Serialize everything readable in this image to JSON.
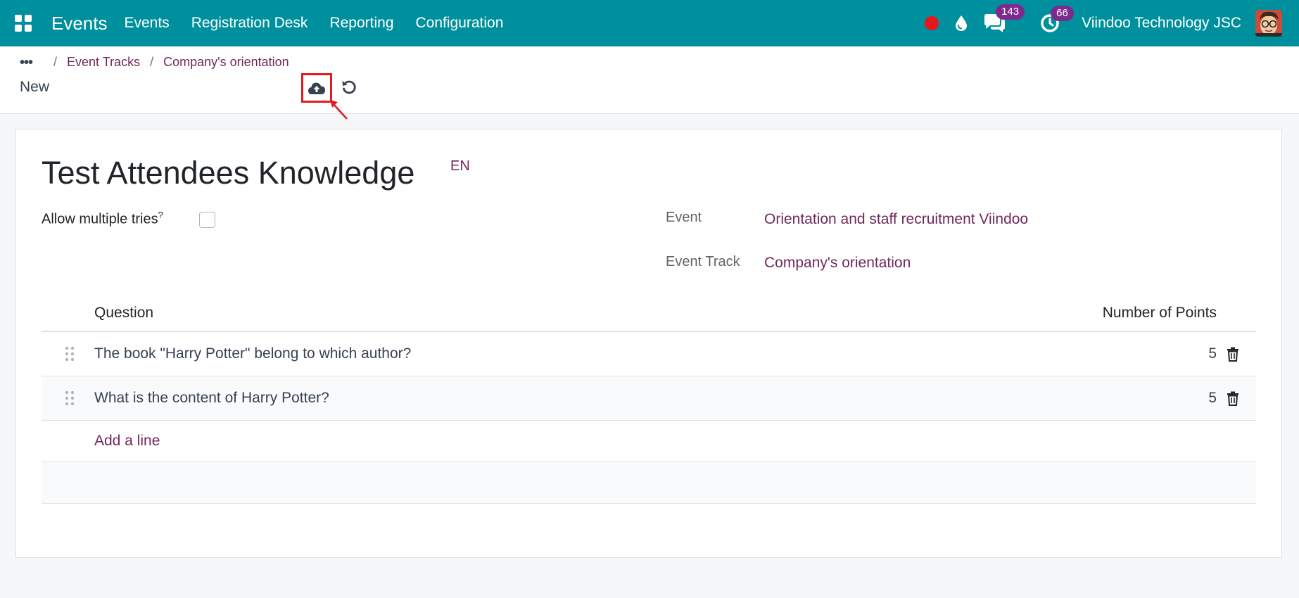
{
  "navbar": {
    "app_title": "Events",
    "menu": [
      "Events",
      "Registration Desk",
      "Reporting",
      "Configuration"
    ],
    "messages_count": "143",
    "activities_count": "66",
    "company": "Viindoo Technology JSC",
    "color": "#00909d"
  },
  "breadcrumb": {
    "items": [
      "Event Tracks",
      "Company's orientation"
    ]
  },
  "status": "New",
  "form": {
    "title": "Test Attendees Knowledge",
    "lang": "EN",
    "allow_multiple_tries_label": "Allow multiple tries",
    "allow_multiple_tries_help": "?",
    "allow_multiple_tries_value": false,
    "event_label": "Event",
    "event_value": "Orientation and staff recruitment Viindoo",
    "track_label": "Event Track",
    "track_value": "Company's orientation"
  },
  "table": {
    "columns": [
      "Question",
      "Number of Points"
    ],
    "rows": [
      {
        "question": "The book \"Harry Potter\" belong to which author?",
        "points": "5"
      },
      {
        "question": "What is the content of Harry Potter?",
        "points": "5"
      }
    ],
    "add_line": "Add a line"
  },
  "icons": {
    "apps": "grid-icon",
    "record": "red-dot-icon",
    "drop": "drop-icon",
    "messages": "chat-icon",
    "activities": "clock-icon",
    "save": "cloud-upload-icon",
    "discard": "undo-icon",
    "handle": "drag-handle-icon",
    "delete": "trash-icon"
  }
}
